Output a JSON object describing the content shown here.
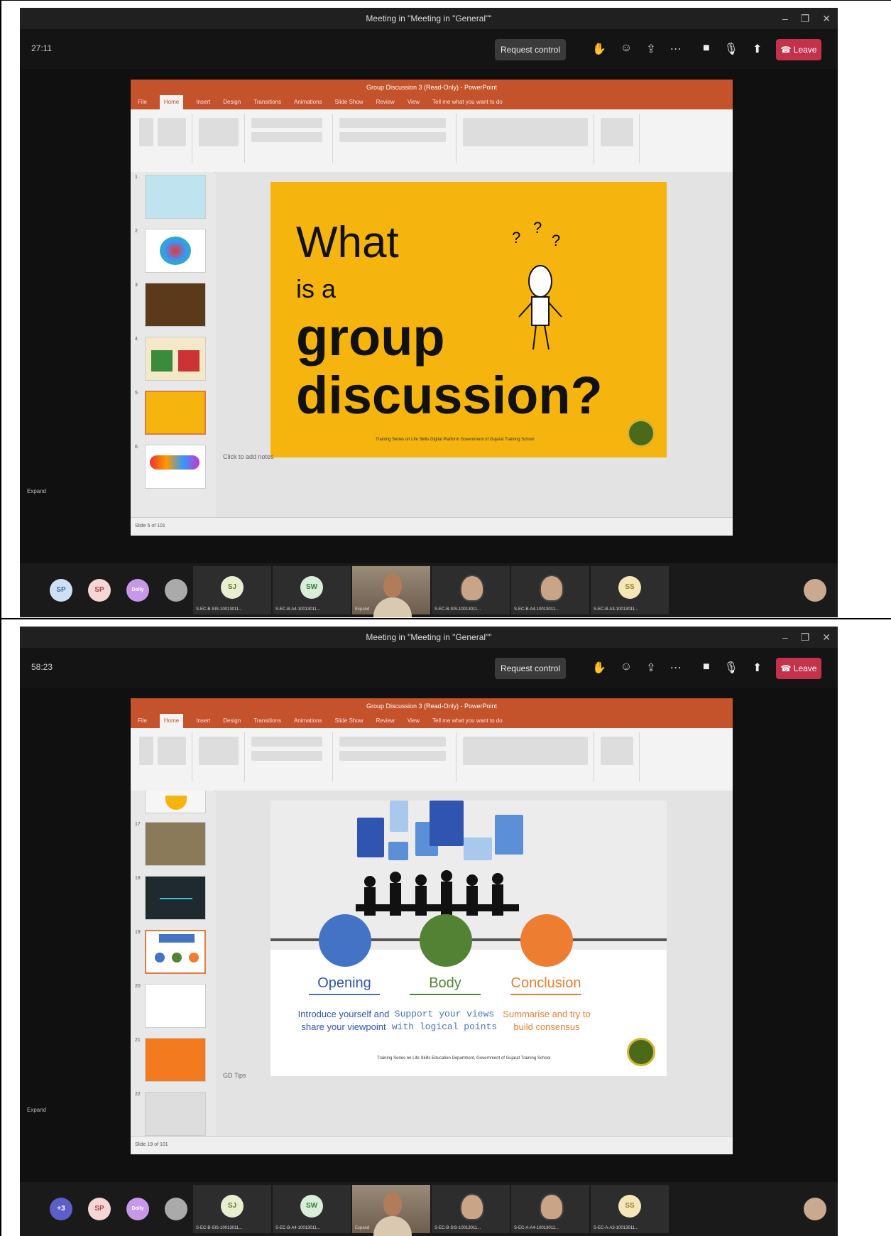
{
  "frames": [
    {
      "window_title": "Meeting in \"Meeting in \"General\"\"",
      "call_timer": "27:11",
      "request_control": "Request control",
      "leave_label": "Leave",
      "ppt_title": "Group Discussion 3 (Read-Only) - PowerPoint",
      "ppt_tabs": [
        "File",
        "Home",
        "Insert",
        "Design",
        "Transitions",
        "Animations",
        "Slide Show",
        "Review",
        "View",
        "Tell me what you want to do"
      ],
      "slide_status": "Slide 5 of 101",
      "notes_placeholder": "Click to add notes",
      "expand_label": "Expand",
      "slide_text": {
        "line1": "What",
        "line2": "is a",
        "line3": "group",
        "line4": "discussion?",
        "footer": "Training Series on Life Skills Digital Platform Government of Gujarat Training School"
      },
      "participants": {
        "avatars": [
          {
            "initials": "SP",
            "color": "#cfe0f5"
          },
          {
            "initials": "SP",
            "color": "#f5d5d5"
          },
          {
            "initials": "Dolly",
            "color": "#c898e8"
          },
          {
            "initials": "",
            "color": "#aaaaaa"
          }
        ],
        "tiles": [
          {
            "initials": "SJ",
            "name": "S-EC-B-SIS-10013011...",
            "color": "#e8efd0"
          },
          {
            "initials": "SW",
            "name": "S-EC-B-A4-10013011...",
            "color": "#d8eed8"
          },
          {
            "initials": "",
            "name": "Expand",
            "video": true
          },
          {
            "initials": "",
            "name": "S-EC-B-SIS-10013011...",
            "photo": true
          },
          {
            "initials": "",
            "name": "S-EC-B-A4-10013011...",
            "photo": true
          },
          {
            "initials": "SS",
            "name": "S-EC-B-A3-10013011...",
            "color": "#f5e6b8"
          }
        ]
      }
    },
    {
      "window_title": "Meeting in \"Meeting in \"General\"\"",
      "call_timer": "58:23",
      "request_control": "Request control",
      "leave_label": "Leave",
      "ppt_title": "Group Discussion 3 (Read-Only) - PowerPoint",
      "ppt_tabs": [
        "File",
        "Home",
        "Insert",
        "Design",
        "Transitions",
        "Animations",
        "Slide Show",
        "Review",
        "View",
        "Tell me what you want to do"
      ],
      "slide_status": "Slide 19 of 101",
      "notes_placeholder": "GD Tips",
      "expand_label": "Expand",
      "slide_text": {
        "col1_head": "Opening",
        "col2_head": "Body",
        "col3_head": "Conclusion",
        "col1_body": "Introduce yourself and share your viewpoint",
        "col2_body": "Support your views with logical points",
        "col3_body": "Summarise and try to build consensus",
        "footer": "Training Series on Life Skills Education Department, Government of Gujarat Training School"
      },
      "participants": {
        "avatars": [
          {
            "initials": "+3",
            "color": "#5b5fc7"
          },
          {
            "initials": "SP",
            "color": "#f5d5d5"
          },
          {
            "initials": "Dolly",
            "color": "#c898e8"
          },
          {
            "initials": "",
            "color": "#aaaaaa"
          }
        ],
        "tiles": [
          {
            "initials": "SJ",
            "name": "S-EC-B-SIS-10013011...",
            "color": "#e8efd0"
          },
          {
            "initials": "SW",
            "name": "S-EC-B-A4-10013011...",
            "color": "#d8eed8"
          },
          {
            "initials": "",
            "name": "Expand",
            "video": true
          },
          {
            "initials": "",
            "name": "S-EC-B-SIS-10013011...",
            "photo": true
          },
          {
            "initials": "",
            "name": "S-EC-A-A4-10013011...",
            "photo": true
          },
          {
            "initials": "SS",
            "name": "S-EC-A-A3-10013011...",
            "color": "#f5e6b8"
          }
        ]
      }
    }
  ],
  "colors": {
    "leave": "#c4314b",
    "ppt_orange": "#c4522a",
    "slide1_bg": "#f6b40e",
    "blue": "#4472c4",
    "green": "#548235",
    "orange": "#ed7d31"
  }
}
